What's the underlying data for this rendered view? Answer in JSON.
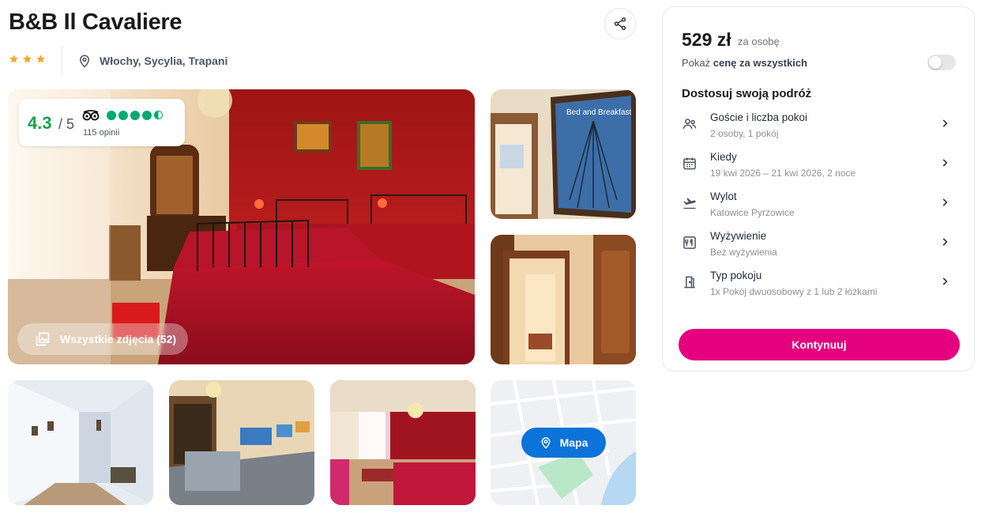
{
  "hotel": {
    "name": "B&B Il Cavaliere",
    "stars": 3,
    "location": "Włochy, Sycylia, Trapani"
  },
  "rating": {
    "score": "4.3",
    "max": "/ 5",
    "reviews": "115 opinii",
    "bubbles_filled": 4.5
  },
  "gallery": {
    "all_photos_label": "Wszystkie zdjęcia (52)",
    "map_label": "Mapa"
  },
  "booking": {
    "price": "529 zł",
    "per_person": "za osobę",
    "show_total_prefix": "Pokaż",
    "show_total_bold": "cenę za wszystkich",
    "toggle_on": false,
    "section_title": "Dostosuj swoją podróż",
    "options": [
      {
        "label": "Goście i liczba pokoi",
        "value": "2 osoby, 1 pokój",
        "icon": "guests-icon"
      },
      {
        "label": "Kiedy",
        "value": "19 kwi 2026 – 21 kwi 2026, 2 noce",
        "icon": "calendar-icon"
      },
      {
        "label": "Wylot",
        "value": "Katowice Pyrzowice",
        "icon": "plane-icon"
      },
      {
        "label": "Wyżywienie",
        "value": "Bez wyżywienia",
        "icon": "meal-icon"
      },
      {
        "label": "Typ pokoju",
        "value": "1x Pokój dwuosobowy z 1 lub 2 łóżkami",
        "icon": "room-door-icon"
      }
    ],
    "cta_label": "Kontynuuj"
  },
  "colors": {
    "accent": "#e5007e",
    "map_button": "#0b73d9",
    "star": "#f5a623",
    "rating_green": "#17a34a"
  }
}
